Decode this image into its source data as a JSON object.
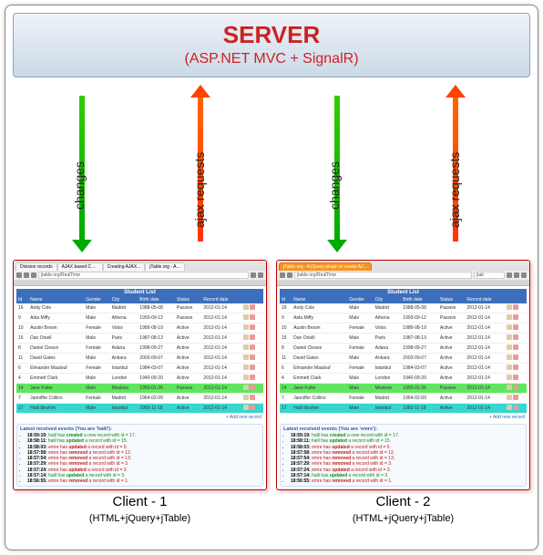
{
  "server": {
    "title": "SERVER",
    "subtitle": "(ASP.NET MVC + SignalR)"
  },
  "arrow_labels": {
    "changes": "changes",
    "ajax": "ajax requests"
  },
  "clients": {
    "c1": {
      "caption": "Client - 1",
      "tech": "(HTML+jQuery+jTable)",
      "browser": "chrome",
      "tabs": [
        "Division records",
        "AJAX based CR...",
        "Creating AJAX...",
        "jTable.org - A..."
      ],
      "address": "jtable.org/RealTime",
      "user": "halil"
    },
    "c2": {
      "caption": "Client - 2",
      "tech": "(HTML+jQuery+jTable)",
      "browser": "firefox",
      "tabs": [
        "jTable.org - A jQuery plugin to create AJ..."
      ],
      "address": "jtable.org/RealTime",
      "search": "jtab",
      "user": "emre"
    }
  },
  "table": {
    "title": "Student List",
    "headers": [
      "Id",
      "Name",
      "Gender",
      "City",
      "Birth date",
      "Status",
      "Record date"
    ],
    "rows": [
      {
        "id": 16,
        "name": "Andy Cole",
        "gender": "Male",
        "city": "Madrid",
        "birth": "1988-05-08",
        "status": "Passive",
        "rec": "2012-01-14",
        "hl": ""
      },
      {
        "id": 9,
        "name": "Aida Miffy",
        "gender": "Male",
        "city": "Athena",
        "birth": "1993-09-12",
        "status": "Passive",
        "rec": "2012-01-14",
        "hl": ""
      },
      {
        "id": 10,
        "name": "Austin Brown",
        "gender": "Female",
        "city": "Volos",
        "birth": "1986-08-19",
        "status": "Active",
        "rec": "2012-01-14",
        "hl": ""
      },
      {
        "id": 15,
        "name": "Dan Oniell",
        "gender": "Male",
        "city": "Paris",
        "birth": "1987-08-13",
        "status": "Active",
        "rec": "2012-01-14",
        "hl": ""
      },
      {
        "id": 8,
        "name": "Daniel Cleave",
        "gender": "Female",
        "city": "Adana",
        "birth": "1998-09-27",
        "status": "Active",
        "rec": "2012-01-14",
        "hl": ""
      },
      {
        "id": 11,
        "name": "David Gates",
        "gender": "Male",
        "city": "Ankara",
        "birth": "2003-09-07",
        "status": "Active",
        "rec": "2012-01-14",
        "hl": ""
      },
      {
        "id": 6,
        "name": "Elmander Maalouf",
        "gender": "Female",
        "city": "Istanbul",
        "birth": "1984-03-07",
        "status": "Active",
        "rec": "2012-01-14",
        "hl": ""
      },
      {
        "id": 4,
        "name": "Emmett Clark",
        "gender": "Male",
        "city": "London",
        "birth": "1940-09-20",
        "status": "Active",
        "rec": "2012-01-14",
        "hl": ""
      },
      {
        "id": 14,
        "name": "Jane Fuller",
        "gender": "Male",
        "city": "Moskow",
        "birth": "1950-01-26",
        "status": "Passive",
        "rec": "2012-01-14",
        "hl": "green"
      },
      {
        "id": 7,
        "name": "Janniffer Collins",
        "gender": "Female",
        "city": "Madrid",
        "birth": "1964-02-09",
        "status": "Active",
        "rec": "2012-01-14",
        "hl": ""
      },
      {
        "id": 17,
        "name": "Halil Ibrahim",
        "gender": "Male",
        "city": "Istanbul",
        "birth": "1983-11-18",
        "status": "Active",
        "rec": "2012-01-14",
        "hl": "teal"
      }
    ],
    "add_new": "+ Add new record"
  },
  "events": {
    "c1_title": "Latest received events (You are 'halil'):",
    "c2_title": "Latest received events (You are 'emre'):",
    "items": [
      {
        "ts": "18:59:19",
        "user": "halil",
        "html": " has <b>created</b> a new record with id = 17."
      },
      {
        "ts": "18:58:11",
        "user": "halil",
        "html": " has <b>updated</b> a record with id = 15."
      },
      {
        "ts": "18:58:03",
        "user": "emre",
        "html": " has <b>updated</b> a record with id = 5."
      },
      {
        "ts": "18:57:58",
        "user": "emre",
        "html": " has <b>removed</b> a record with id = 12."
      },
      {
        "ts": "18:57:54",
        "user": "emre",
        "html": " has <b>removed</b> a record with id = 13."
      },
      {
        "ts": "18:57:29",
        "user": "emre",
        "html": " has <b>removed</b> a record with id = 3."
      },
      {
        "ts": "18:57:24",
        "user": "emre",
        "html": " has <b>updated</b> a record with id = 3."
      },
      {
        "ts": "18:57:14",
        "user": "halil",
        "html": " has <b>updated</b> a record with id = 3."
      },
      {
        "ts": "18:56:55",
        "user": "emre",
        "html": " has <b>removed</b> a record with id = 1."
      }
    ]
  }
}
